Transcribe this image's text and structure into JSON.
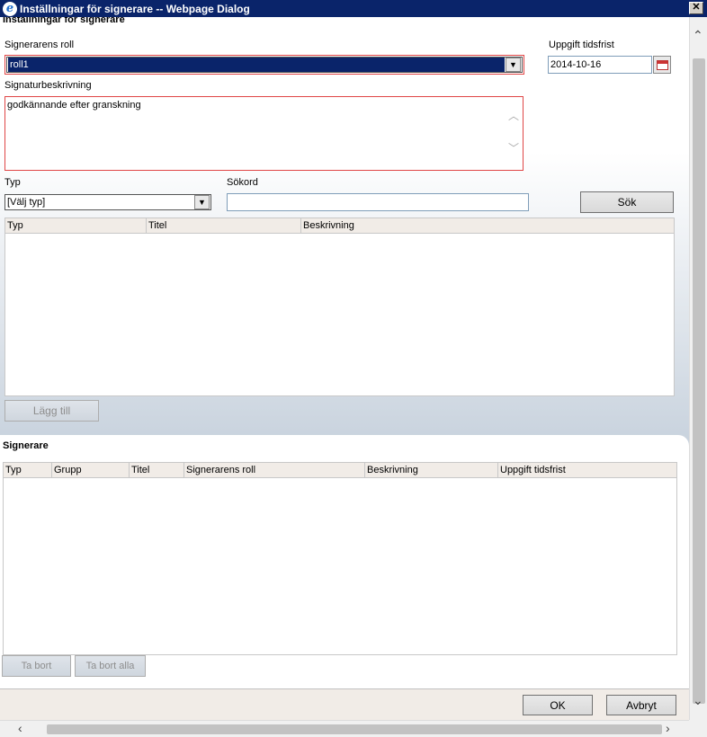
{
  "window": {
    "title": "Inställningar för signerare -- Webpage Dialog",
    "close_glyph": "✕"
  },
  "settings": {
    "section_title": "Inställningar för signerare",
    "role_label": "Signerarens roll",
    "role_value": "roll1",
    "deadline_label": "Uppgift tidsfrist",
    "deadline_value": "2014-10-16",
    "description_label": "Signaturbeskrivning",
    "description_value": "godkännande efter granskning"
  },
  "search": {
    "type_label": "Typ",
    "type_value": "[Välj typ]",
    "keyword_label": "Sökord",
    "keyword_value": "",
    "search_button": "Sök"
  },
  "results_grid": {
    "columns": [
      "Typ",
      "Titel",
      "Beskrivning"
    ]
  },
  "add_button": "Lägg till",
  "signers": {
    "section_title": "Signerare",
    "columns": [
      "Typ",
      "Grupp",
      "Titel",
      "Signerarens roll",
      "Beskrivning",
      "Uppgift tidsfrist"
    ],
    "remove_button": "Ta bort",
    "remove_all_button": "Ta bort alla"
  },
  "footer": {
    "ok_button": "OK",
    "cancel_button": "Avbryt"
  },
  "icons": {
    "dropdown": "▼",
    "scroll_up": "︿",
    "scroll_down": "﹀"
  }
}
